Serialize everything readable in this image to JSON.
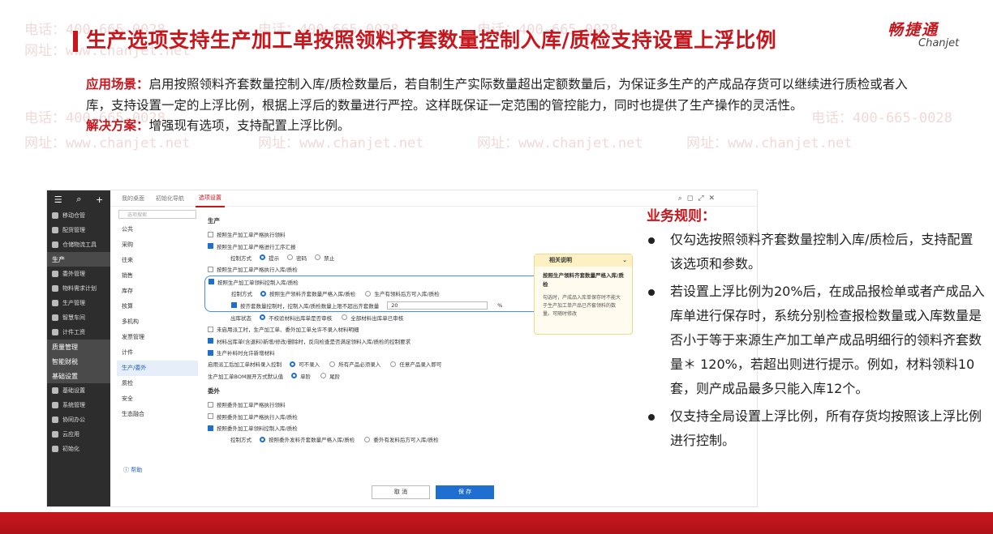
{
  "watermark": {
    "phone": "电话：400-665-0028",
    "site": "网址：www.chanjet.net"
  },
  "slide": {
    "title": "生产选项支持生产加工单按照领料齐套数量控制入库/质检支持设置上浮比例",
    "logo_cn": "畅捷通",
    "logo_en": "Chanjet",
    "scenario_label": "应用场景：",
    "scenario_text": "启用按照领料齐套数量控制入库/质检数量后，若自制生产实际数量超出定额数量后，为保证多生产的产成品存货可以继续进行质检或者入库，支持设置一定的上浮比例，根据上浮后的数量进行严控。这样既保证一定范围的管控能力，同时也提供了生产操作的灵活性。",
    "solution_label": "解决方案：",
    "solution_text": "增强现有选项，支持配置上浮比例。"
  },
  "app": {
    "sidebar": {
      "items": [
        "移动仓管",
        "配货管理",
        "仓储物流工具",
        "生产",
        "委外管理",
        "物料需求计划",
        "生产管理",
        "智慧车间",
        "计件工资",
        "质量管理",
        "智能财税",
        "基础设置",
        "基础设置",
        "系统管理",
        "协同办公",
        "云应用",
        "初始化"
      ]
    },
    "tabs": [
      "我的桌面",
      "初始化导航",
      "选项设置"
    ],
    "search_placeholder": "选项搜索",
    "categories": [
      "公共",
      "采购",
      "往来",
      "销售",
      "库存",
      "核算",
      "多机构",
      "发票管理",
      "计件",
      "生产/委外",
      "质检",
      "安全",
      "生态融合"
    ],
    "help": "帮助",
    "section_production": "生产",
    "opt1": "按照生产加工单严格执行领料",
    "opt2": "按照生产加工单严格进行工序汇报",
    "ctl_mode": "控制方式",
    "ctl_prompt": "提示",
    "ctl_password": "密码",
    "ctl_forbid": "禁止",
    "opt3": "按照生产加工单严格执行入库/质检",
    "opt4": "按照生产加工单领料控制入库/质检",
    "ctl_kit": "按照生产领料齐套数量严格入库/质检",
    "ctl_any": "生产有领料后方可入库/质检",
    "float_label": "按齐套数量控制时，控制入库/质检数量上限不超出齐套数量",
    "float_value": "20",
    "float_unit": "%",
    "status_label": "出库状态",
    "status_a": "不校验材料出库单是否审核",
    "status_b": "全部材料出库单已审核",
    "opt5": "未启用派工时，生产加工单、委外加工单允许不录入材料明细",
    "opt6": "材料出库单(含退料)新增/修改/删除时，反向检查是否满足领料入库/质检的控制要求",
    "opt7": "生产补料时允许新增材料",
    "ctrl_enable": "启用派工后加工单材料录入控制",
    "ctrl_a": "可不录入",
    "ctrl_b": "所有产品必须录入",
    "ctrl_c": "任意产品录入即可",
    "bom_label": "生产加工单BOM展开方式默认值",
    "bom_a": "单阶",
    "bom_b": "尾阶",
    "section_outsource": "委外",
    "o1": "按照委外加工单严格执行领料",
    "o2": "按照委外加工单严格执行入库/质检",
    "o3": "按照委外加工单领料控制入库/质检",
    "o_kit": "按照委外发料齐套数量严格入库/质检",
    "o_any": "委外有发料后方可入库/质检",
    "tip_title": "相关说明",
    "tip_head": "按照生产领料齐套数量严格入库/质检",
    "tip_body": "勾选时，产成品入库单保存时不能大于生产加工单产品已齐套领料的数量。可随时修改",
    "cancel": "取 消",
    "save": "保 存"
  },
  "rules": {
    "title": "业务规则：",
    "items": [
      "仅勾选按照领料齐套数量控制入库/质检后，支持配置该选项和参数。",
      "若设置上浮比例为20%后，在成品报检单或者产成品入库单进行保存时，系统分别检查报检数量或入库数量是否小于等于来源生产加工单产成品明细行的领料齐套数量＊ 120%，若超出则进行提示。例如，材料领料10套，则产成品最多只能入库12个。",
      "仅支持全局设置上浮比例，所有存货均按照该上浮比例进行控制。"
    ]
  }
}
